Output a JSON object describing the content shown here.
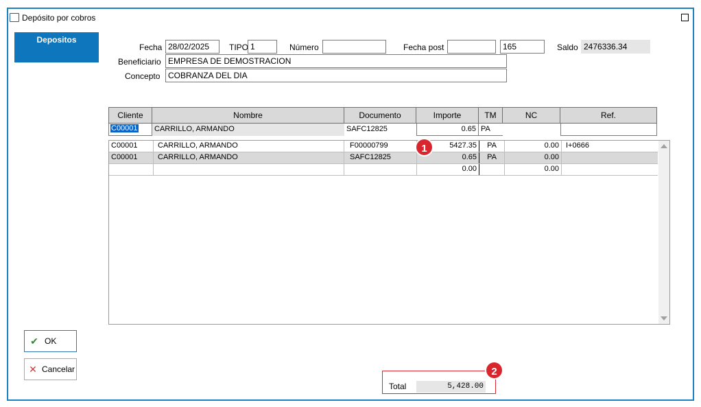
{
  "window": {
    "title": "Depósito por cobros"
  },
  "tab": {
    "label": "Depositos"
  },
  "form": {
    "fecha_label": "Fecha",
    "fecha_value": "28/02/2025",
    "tipo_label": "TIPO",
    "tipo_value": "1",
    "numero_label": "Número",
    "numero_value": "",
    "fecha_post_label": "Fecha post",
    "fecha_post_value": "",
    "fecha_post_extra": "165",
    "saldo_label": "Saldo",
    "saldo_value": "2476336.34",
    "beneficiario_label": "Beneficiario",
    "beneficiario_value": "EMPRESA DE DEMOSTRACION",
    "concepto_label": "Concepto",
    "concepto_value": "COBRANZA DEL DIA"
  },
  "grid": {
    "columns": [
      "Cliente",
      "Nombre",
      "Documento",
      "Importe",
      "TM",
      "NC",
      "Ref."
    ],
    "edit_row": {
      "cliente": "C00001",
      "nombre": "CARRILLO, ARMANDO",
      "documento": "SAFC12825",
      "importe": "0.65",
      "tm": "PA",
      "nc": "",
      "ref": ""
    },
    "rows": [
      {
        "cliente": "C00001",
        "nombre": "CARRILLO, ARMANDO",
        "documento": "F00000799",
        "importe": "5427.35",
        "tm": "PA",
        "nc": "0.00",
        "ref": "I+0666"
      },
      {
        "cliente": "C00001",
        "nombre": "CARRILLO, ARMANDO",
        "documento": "SAFC12825",
        "importe": "0.65",
        "tm": "PA",
        "nc": "0.00",
        "ref": ""
      },
      {
        "cliente": "",
        "nombre": "",
        "documento": "",
        "importe": "0.00",
        "tm": "",
        "nc": "0.00",
        "ref": ""
      }
    ]
  },
  "buttons": {
    "ok_label": "OK",
    "cancel_label": "Cancelar"
  },
  "total": {
    "label": "Total",
    "value": "5,428.00"
  },
  "badges": {
    "one": "1",
    "two": "2"
  },
  "icons": {
    "ok": "check-icon",
    "cancel": "x-icon"
  },
  "colors": {
    "accent": "#0d76bd",
    "badge": "#d9262e"
  }
}
